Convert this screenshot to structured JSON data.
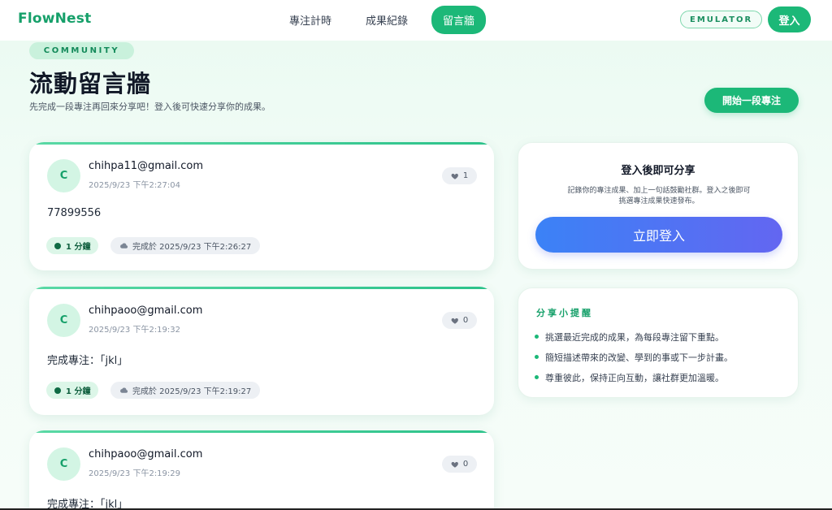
{
  "brand": "FlowNest",
  "nav": {
    "items": [
      "專注計時",
      "成果紀錄",
      "留言牆"
    ],
    "active_index": 2
  },
  "emulator_badge": "EMULATOR",
  "login_top": "登入",
  "header": {
    "badge": "COMMUNITY",
    "title": "流動留言牆",
    "subtitle": "先完成一段專注再回來分享吧！登入後可快速分享你的成果。",
    "start_button": "開始一段專注"
  },
  "posts": [
    {
      "avatar": "C",
      "author": "chihpa11@gmail.com",
      "time": "2025/9/23 下午2:27:04",
      "likes": "1",
      "body": "77899556",
      "duration": "1 分鐘",
      "completed": "完成於 2025/9/23 下午2:26:27"
    },
    {
      "avatar": "C",
      "author": "chihpaoo@gmail.com",
      "time": "2025/9/23 下午2:19:32",
      "likes": "0",
      "body": "完成專注：「jkl」",
      "duration": "1 分鐘",
      "completed": "完成於 2025/9/23 下午2:19:27"
    },
    {
      "avatar": "C",
      "author": "chihpaoo@gmail.com",
      "time": "2025/9/23 下午2:19:29",
      "likes": "0",
      "body": "完成專注：「jkl」"
    }
  ],
  "login_card": {
    "title": "登入後即可分享",
    "desc_line1": "記錄你的專注成果、加上一句話鼓勵社群。登入之後即可",
    "desc_line2": "挑選專注成果快速發布。",
    "button": "立即登入"
  },
  "tips": {
    "title": "分享小提醒",
    "items": [
      "挑選最近完成的成果，為每段專注留下重點。",
      "簡短描述帶來的改變、學到的事或下一步計畫。",
      "尊重彼此，保持正向互動，讓社群更加溫暖。"
    ]
  },
  "colors": {
    "brand": "#16a06a",
    "accent": "#1cb878",
    "login_gradient_start": "#3b82f6",
    "login_gradient_end": "#6366f1"
  }
}
